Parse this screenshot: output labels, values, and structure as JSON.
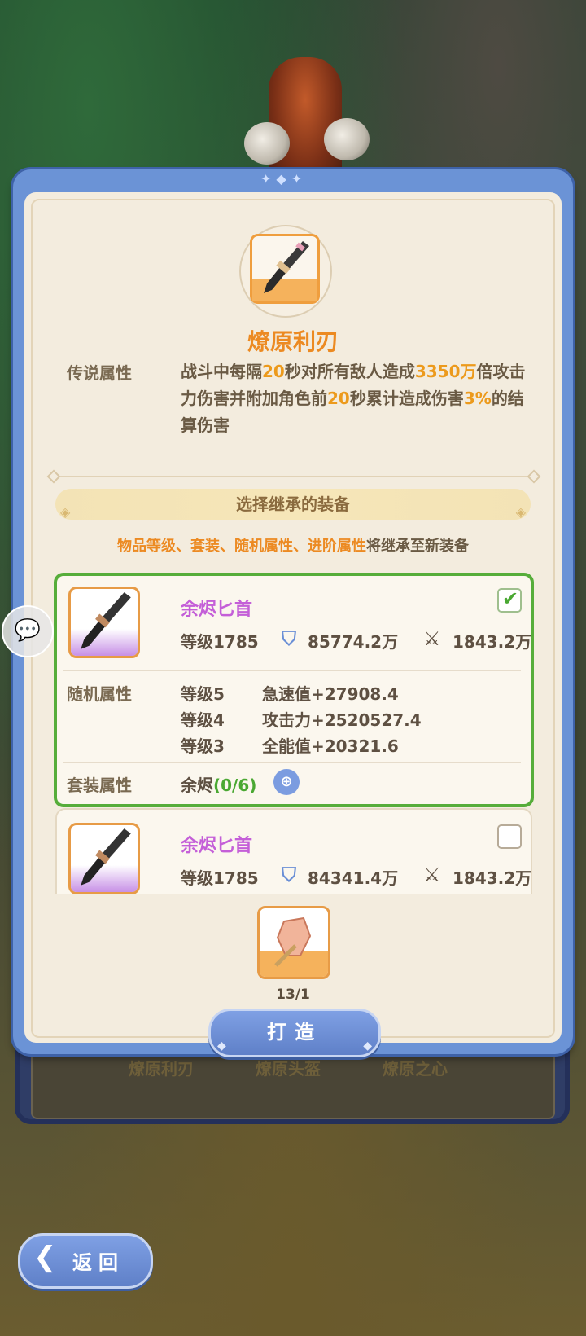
{
  "background_tabs": [
    "燎原利刃",
    "燎原头盔",
    "燎原之心"
  ],
  "item": {
    "name": "燎原利刃",
    "legend_label": "传说属性",
    "legend_parts": [
      "战斗中每隔",
      "20",
      "秒对所有敌人造成",
      "3350万",
      "倍攻击力伤害并附加角色前",
      "20",
      "秒累计造成伤害",
      "3%",
      "的结算伤害"
    ]
  },
  "choose_title": "选择继承的装备",
  "inherit": {
    "highlight": "物品等级、套装、随机属性、进阶属性",
    "rest": "将继承至新装备"
  },
  "cards": [
    {
      "name": "余烬匕首",
      "level": "等级1785",
      "defense": "85774.2万",
      "attack": "1843.2万",
      "checked": true,
      "random_label": "随机属性",
      "random": [
        {
          "level": "等级5",
          "value": "急速值+27908.4"
        },
        {
          "level": "等级4",
          "value": "攻击力+2520527.4"
        },
        {
          "level": "等级3",
          "value": "全能值+20321.6"
        }
      ],
      "set_label": "套装属性",
      "set_name": "余烬",
      "set_progress": "(0/6)"
    },
    {
      "name": "余烬匕首",
      "level": "等级1785",
      "defense": "84341.4万",
      "attack": "1843.2万",
      "checked": false
    }
  ],
  "material_count": "13/1",
  "forge_label": "打造",
  "back_label": "返回",
  "icons": [
    "dagger-icon",
    "shield-icon",
    "crossed-swords-icon",
    "check-icon",
    "zoom-icon",
    "chat-icon",
    "crystal-icon",
    "back-arrow-icon"
  ],
  "colors": {
    "accent": "#ec8a22",
    "rarity_purple": "#c45fd8",
    "selected_green": "#56ad3a",
    "button_blue": "#6b93d6"
  }
}
